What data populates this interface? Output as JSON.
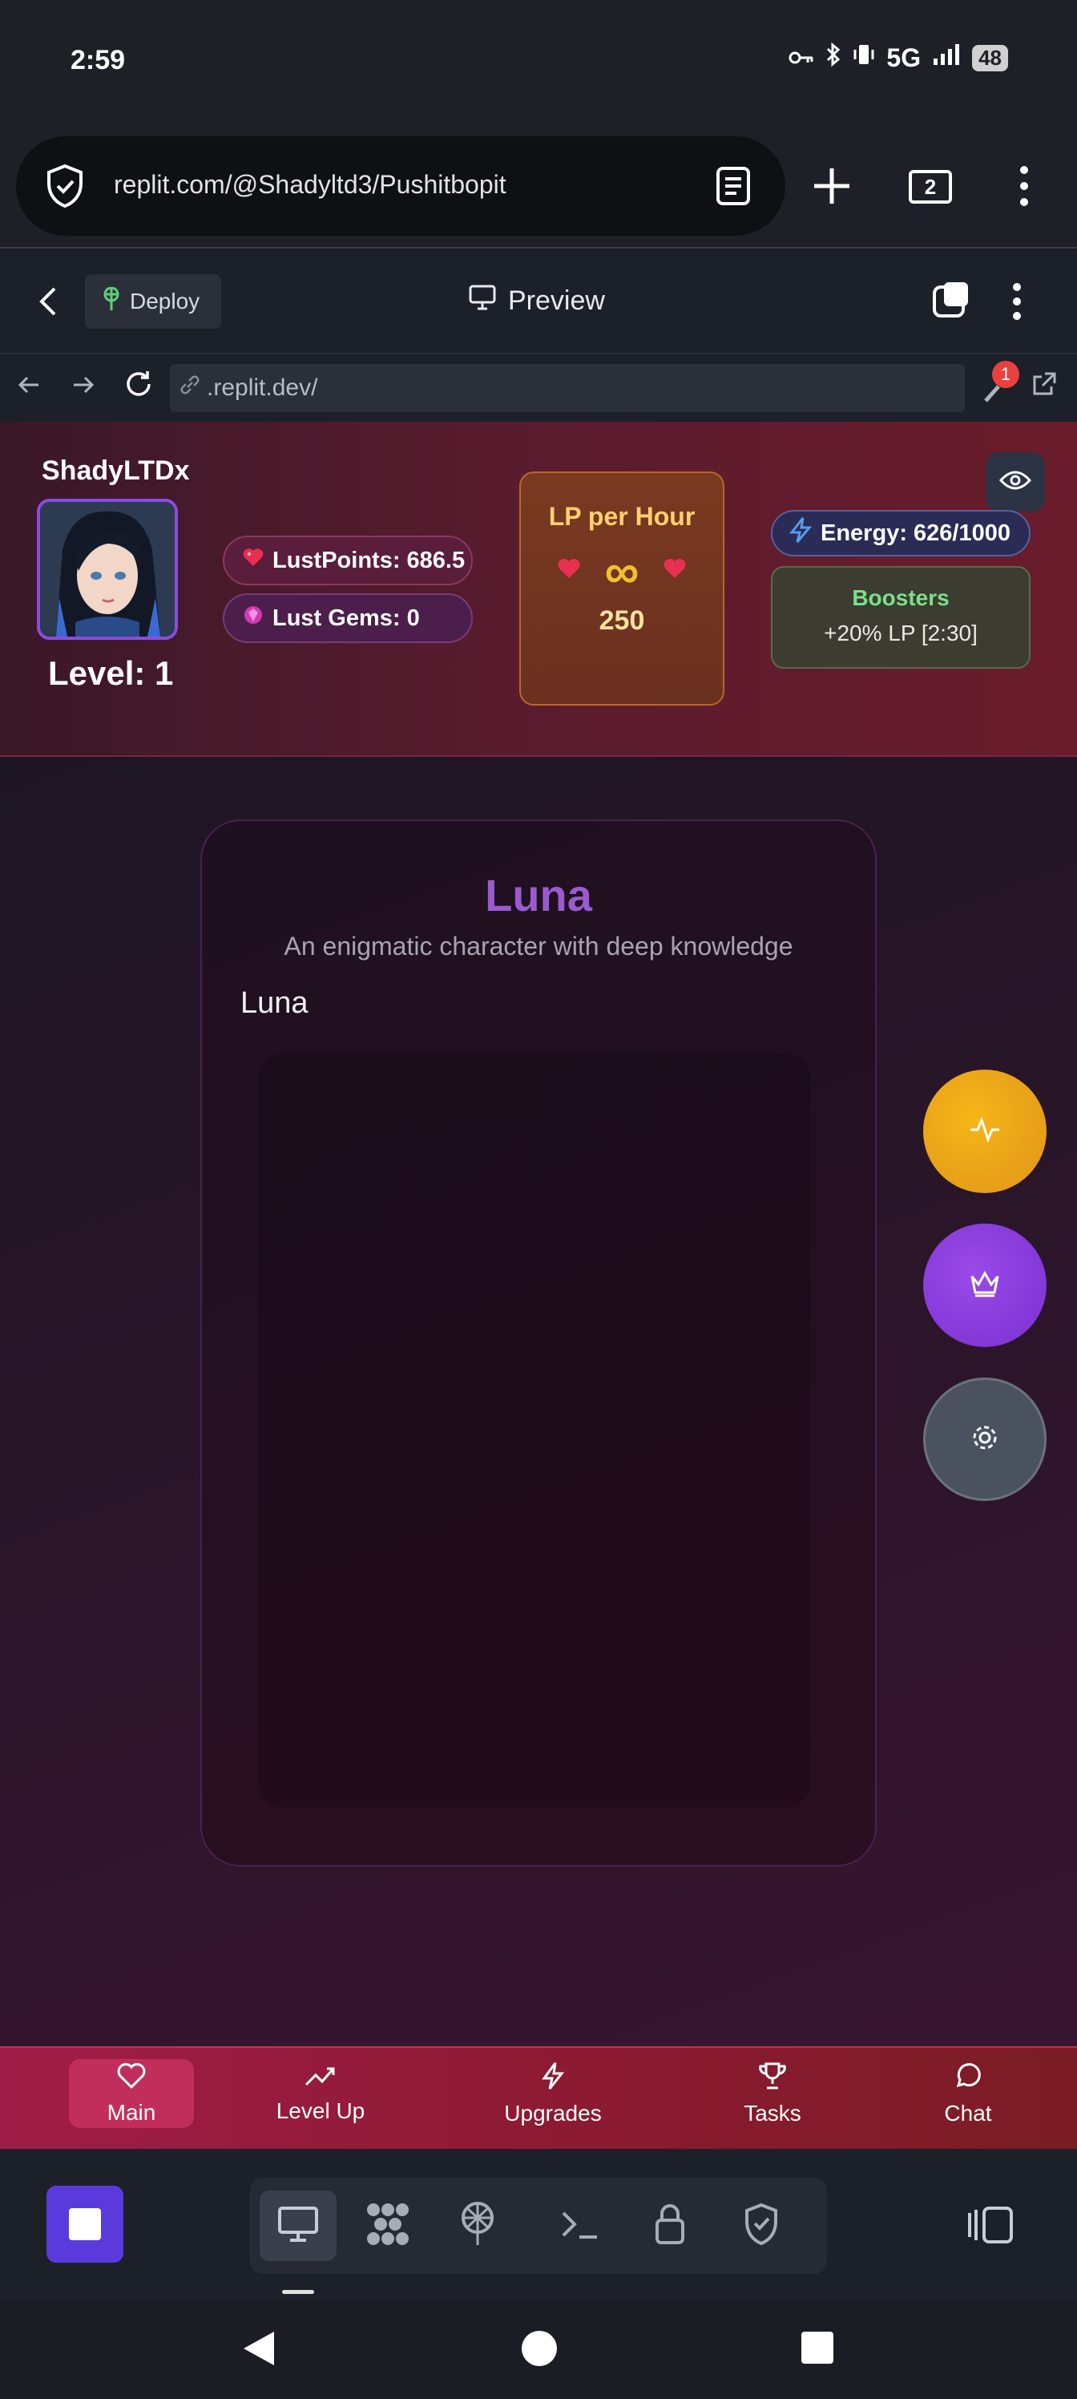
{
  "status_bar": {
    "time": "2:59",
    "network": "5G",
    "battery": "48"
  },
  "browser": {
    "url": "replit.com/@Shadyltd3/Pushitbopit",
    "tab_count": "2"
  },
  "replit_toolbar": {
    "deploy_label": "Deploy",
    "preview_label": "Preview"
  },
  "preview_nav": {
    "url": ".replit.dev/",
    "devtools_badge": "1"
  },
  "player": {
    "username": "ShadyLTDx",
    "level": "Level: 1",
    "lust_points": "LustPoints: 686.5",
    "lust_gems": "Lust Gems: 0"
  },
  "lp_card": {
    "title": "LP per Hour",
    "symbol": "∞",
    "value": "250"
  },
  "energy": "Energy: 626/1000",
  "boosters": {
    "title": "Boosters",
    "value": "+20% LP [2:30]"
  },
  "character": {
    "name": "Luna",
    "description": "An enigmatic character with deep knowledge",
    "image_alt": "Luna"
  },
  "bottom_nav": {
    "items": [
      {
        "label": "Main",
        "icon": "heart-icon"
      },
      {
        "label": "Level Up",
        "icon": "trending-up-icon"
      },
      {
        "label": "Upgrades",
        "icon": "bolt-icon"
      },
      {
        "label": "Tasks",
        "icon": "trophy-icon"
      },
      {
        "label": "Chat",
        "icon": "chat-icon"
      }
    ]
  },
  "colors": {
    "accent": "#c22e5c",
    "character_name": "#9a5ad0",
    "lp_gold": "#ffd070",
    "booster_green": "#7ae08a"
  }
}
